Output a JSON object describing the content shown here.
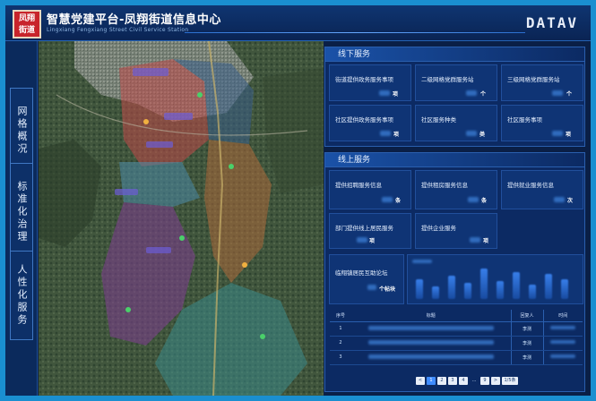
{
  "header": {
    "logo_line1": "凤翔",
    "logo_line2": "街道",
    "title": "智慧党建平台-凤翔街道信息中心",
    "subtitle": "Lingxiang Fengxiang Street Civil Service Station",
    "brand": "DATAV"
  },
  "sidebar": {
    "items": [
      {
        "label": "网格概况"
      },
      {
        "label": "标准化治理"
      },
      {
        "label": "人性化服务"
      }
    ]
  },
  "offline": {
    "title": "线下服务",
    "cards": [
      {
        "label": "街道提供政务服务事项",
        "unit": "项"
      },
      {
        "label": "二级网格党群服务站",
        "unit": "个"
      },
      {
        "label": "三级网格党群服务站",
        "unit": "个"
      },
      {
        "label": "社区提供政务服务事项",
        "unit": "项"
      },
      {
        "label": "社区服务种类",
        "unit": "类"
      },
      {
        "label": "社区服务事项",
        "unit": "项"
      }
    ]
  },
  "online": {
    "title": "线上服务",
    "cards": [
      {
        "label": "提供招聘服务信息",
        "unit": "条"
      },
      {
        "label": "提供租房服务信息",
        "unit": "条"
      },
      {
        "label": "提供就业服务信息",
        "unit": "次"
      },
      {
        "label": "部门提供线上居民服务",
        "unit": "项"
      },
      {
        "label": "提供企业服务",
        "unit": "项"
      }
    ],
    "forum_label": "临翔镇居民互助论坛",
    "forum_unit": "个帖块"
  },
  "table": {
    "headers": [
      "序号",
      "标题",
      "回复人",
      "时间"
    ],
    "rows": [
      {
        "index": "1",
        "reply": "李测"
      },
      {
        "index": "2",
        "reply": "李测"
      },
      {
        "index": "3",
        "reply": "李测"
      }
    ]
  },
  "pager": {
    "pages": [
      "<",
      "1",
      "2",
      "3",
      "4",
      "...",
      "9",
      ">"
    ],
    "goto": "1/5条",
    "active": "1"
  },
  "colors": {
    "background": "#1a8fd0",
    "panel": "#0c2a63",
    "accent": "#3f8cff"
  }
}
